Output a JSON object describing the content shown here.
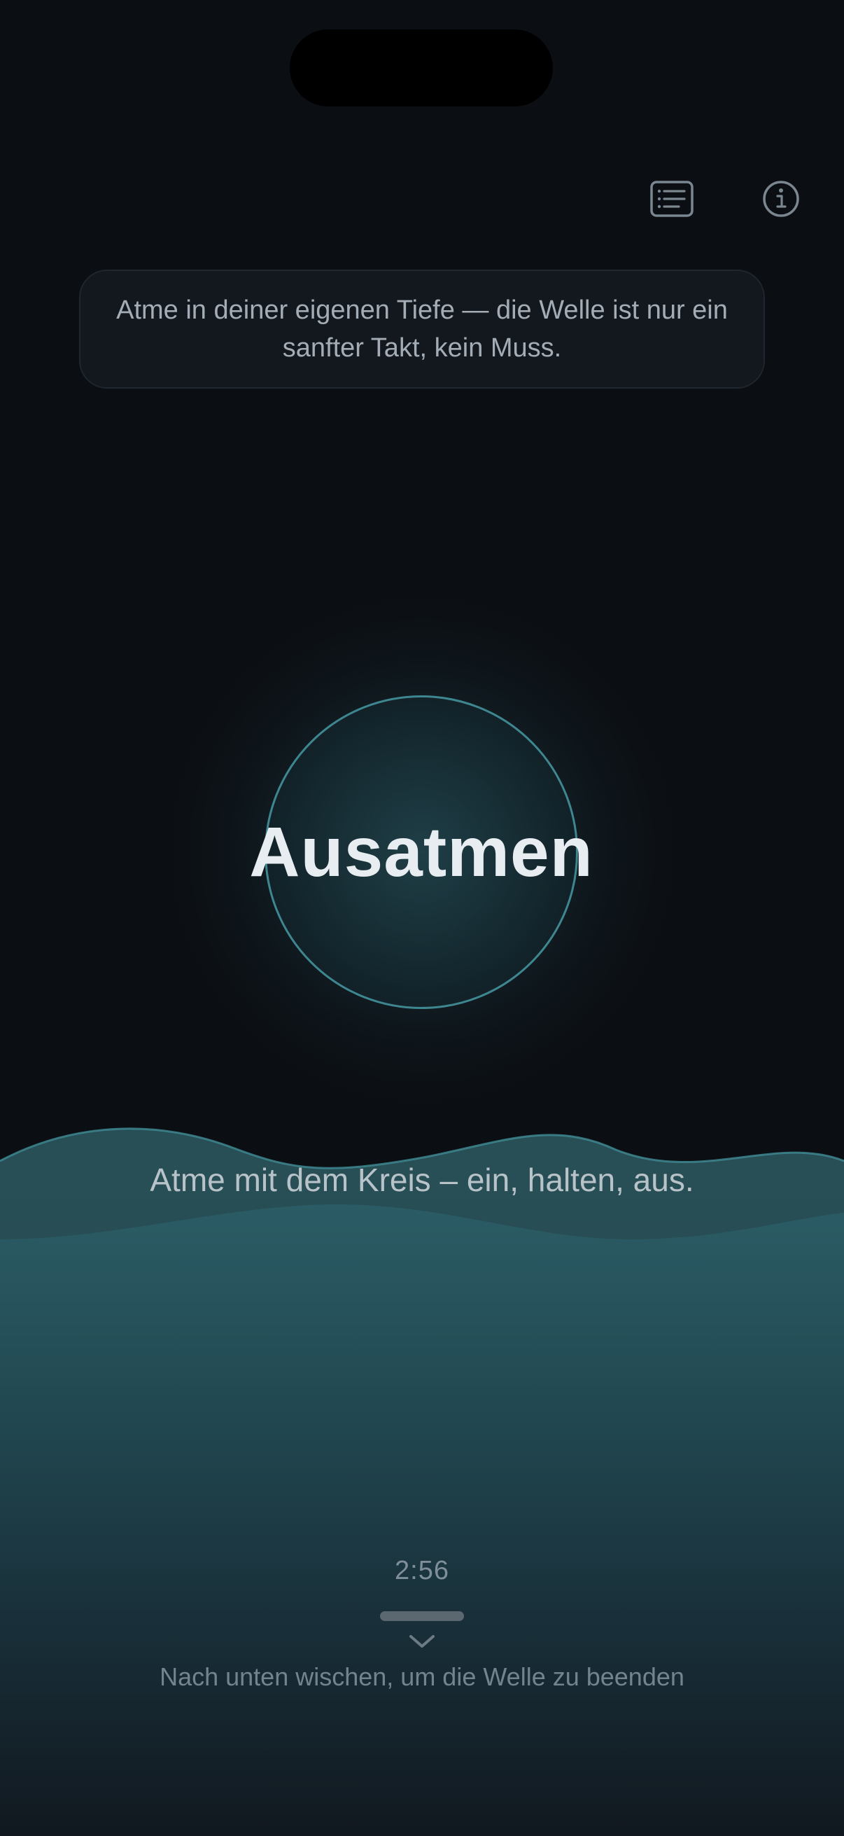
{
  "header": {
    "list_icon": "list-icon",
    "info_icon": "info-icon"
  },
  "hint": {
    "text": "Atme in deiner eigenen Tiefe — die Welle ist nur ein sanfter Takt, kein Muss."
  },
  "breath": {
    "phase": "Ausatmen"
  },
  "instruction": {
    "text": "Atme mit dem Kreis – ein, halten, aus."
  },
  "footer": {
    "timer": "2:56",
    "chevron_icon": "chevron-down-icon",
    "swipe_hint": "Nach unten wischen, um die Welle zu beenden"
  },
  "colors": {
    "background": "#0b0e12",
    "accent_teal": "#3e8790",
    "wave_top": "#2a5a63",
    "text_primary": "#e8edf2",
    "text_secondary": "#a4adb6"
  }
}
